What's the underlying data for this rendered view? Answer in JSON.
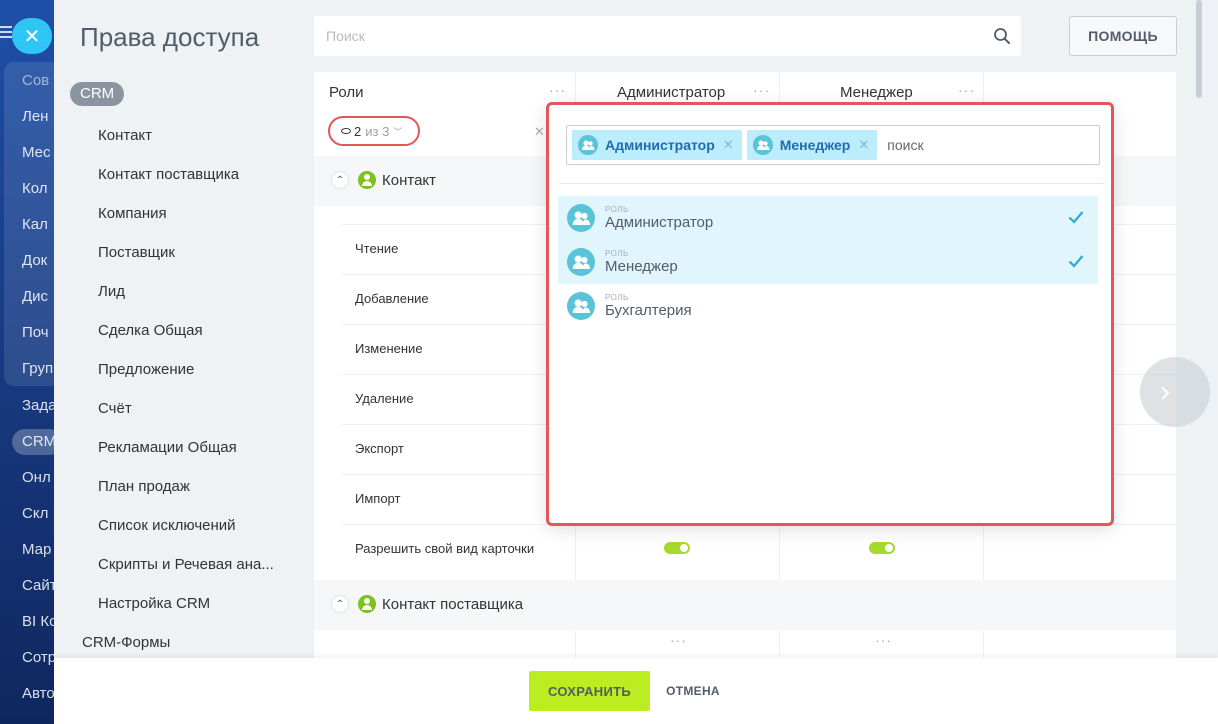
{
  "appnav": {
    "items": [
      "Сов",
      "Лен",
      "Мес",
      "Кол",
      "Кал",
      "Док",
      "Дис",
      "Поч",
      "Груп",
      "Зада",
      "CRM",
      "Онл",
      "Скл",
      "Мар",
      "Сайт",
      "BI Ко",
      "Сотр",
      "Авто"
    ],
    "close_label": "✕"
  },
  "page": {
    "title": "Права доступа"
  },
  "sidebar": {
    "badge": "CRM",
    "items": [
      "Контакт",
      "Контакт поставщика",
      "Компания",
      "Поставщик",
      "Лид",
      "Сделка Общая",
      "Предложение",
      "Счёт",
      "Рекламации Общая",
      "План продаж",
      "Список исключений",
      "Скрипты и Речевая ана...",
      "Настройка CRM"
    ],
    "bottom_item": "CRM-Формы"
  },
  "search": {
    "placeholder": "Поиск"
  },
  "help": {
    "label": "ПОМОЩЬ"
  },
  "table": {
    "roles_header": "Роли",
    "columns": [
      "Администратор",
      "Менеджер"
    ],
    "filter": {
      "count": "2",
      "of_total": "из 3"
    },
    "sections": [
      {
        "title": "Контакт"
      },
      {
        "title": "Контакт поставщика"
      }
    ],
    "permissions": [
      "Чтение",
      "Добавление",
      "Изменение",
      "Удаление",
      "Экспорт",
      "Импорт",
      "Разрешить свой вид карточки"
    ],
    "toggle_states": {
      "admin": true,
      "manager": true
    }
  },
  "popup": {
    "selected_tags": [
      "Администратор",
      "Менеджер"
    ],
    "search_placeholder": "поиск",
    "options": [
      {
        "caption": "РОЛЬ",
        "name": "Администратор",
        "selected": true
      },
      {
        "caption": "РОЛЬ",
        "name": "Менеджер",
        "selected": true
      },
      {
        "caption": "РОЛЬ",
        "name": "Бухгалтерия",
        "selected": false
      }
    ]
  },
  "footer": {
    "save": "СОХРАНИТЬ",
    "cancel": "ОТМЕНА"
  },
  "colors": {
    "accent_red": "#e5565b",
    "save_green": "#bbed21",
    "tag_blue": "#bcedfc",
    "toggle_green": "#a5d92d"
  }
}
